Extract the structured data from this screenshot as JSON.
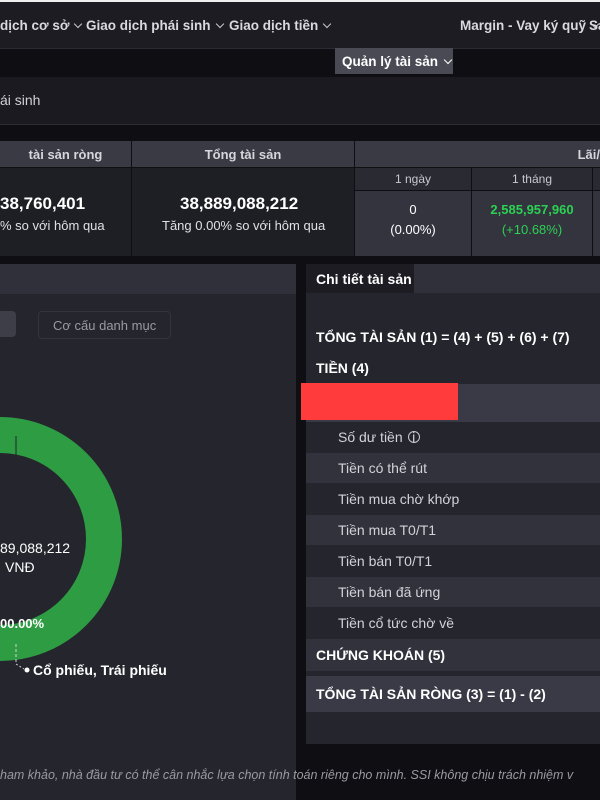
{
  "nav": {
    "items": [
      "dịch cơ sở",
      "Giao dịch phái sinh",
      "Giao dịch tiền",
      "Quản lý tài sản",
      "Margin - Vay ký quỹ",
      "Sa"
    ]
  },
  "subheader": {
    "title": "ái sinh"
  },
  "summary": {
    "net_assets": {
      "header": "tài sản ròng",
      "value": "38,760,401",
      "change": "% so với hôm qua"
    },
    "total_assets": {
      "header": "Tổng tài sản",
      "value": "38,889,088,212",
      "change": "Tăng 0.00% so với hôm qua"
    },
    "profit": {
      "header": "Lãi/",
      "day": {
        "label": "1 ngày",
        "value": "0",
        "pct": "(0.00%)"
      },
      "month": {
        "label": "1 tháng",
        "value": "2,585,957,960",
        "pct": "(+10.68%)"
      }
    }
  },
  "left_panel": {
    "portfolio_button": "Cơ cấu danh mục",
    "donut": {
      "center_value": "89,088,212",
      "center_unit": "VNĐ",
      "pct_label": "00.00%",
      "legend_label": "Cổ phiếu, Trái phiếu",
      "color": "#2e9c43"
    }
  },
  "right_panel": {
    "tab": "Chi tiết tài sản",
    "total_formula": "TỔNG TÀI SẢN (1) = (4) + (5) + (6) + (7)",
    "cash_title": "TIỀN (4)",
    "rows": [
      "Số dư tiền",
      "Tiền có thể rút",
      "Tiền mua chờ khớp",
      "Tiền mua T0/T1",
      "Tiền bán T0/T1",
      "Tiền bán đã ứng",
      "Tiền cổ tức chờ về"
    ],
    "securities_title": "CHỨNG KHOÁN (5)",
    "net_formula": "TỔNG TÀI SẢN RÒNG (3) = (1) - (2)"
  },
  "footer": {
    "disclaimer": "ham khảo, nhà đầu tư có thể cân nhắc lựa chọn tính toán riêng cho mình. SSI không chịu trách nhiệm v"
  }
}
